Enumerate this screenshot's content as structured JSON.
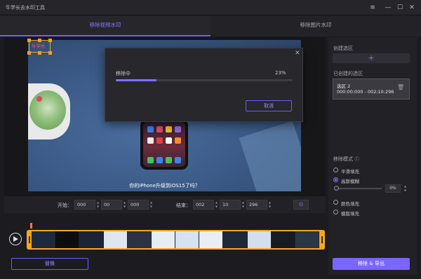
{
  "window": {
    "title": "牛学长去水印工具",
    "controls": [
      "menu-icon",
      "minimize-icon",
      "maximize-icon",
      "close-icon"
    ]
  },
  "tabs": [
    {
      "label": "移除视频水印",
      "active": true
    },
    {
      "label": "移除图片水印",
      "active": false
    }
  ],
  "preview": {
    "watermark_text": "牛学长",
    "subtitle": "你的iPhone升级到iOS15了吗？"
  },
  "dialog": {
    "status": "移除中",
    "percent_text": "23%",
    "progress": 0.23,
    "cancel_label": "取消"
  },
  "time_controls": {
    "start_label": "开始：",
    "start": [
      "000",
      "00",
      "000"
    ],
    "end_label": "结束：",
    "end": [
      "002",
      "10",
      "296"
    ]
  },
  "bottom": {
    "replace_label": "替换",
    "export_label": "移除 & 导出"
  },
  "right_panel": {
    "create_selection_label": "创建选区",
    "created_selections_label": "已创建的选区",
    "selection": {
      "name": "选区 2",
      "time_range": "000:00:000 - 002:10:296"
    },
    "removal_mode_label": "移除模式 ⓘ",
    "modes": [
      {
        "label": "平滑填充",
        "selected": false
      },
      {
        "label": "高斯模糊",
        "selected": true
      },
      {
        "label": "颜色填充",
        "selected": false
      },
      {
        "label": "模版填充",
        "selected": false
      }
    ],
    "blur_value": "0%"
  },
  "colors": {
    "accent": "#7a66ff",
    "timeline_frame": "#f6a623",
    "playhead": "#ff7a2a",
    "watermark_box": "#f4a21a"
  }
}
